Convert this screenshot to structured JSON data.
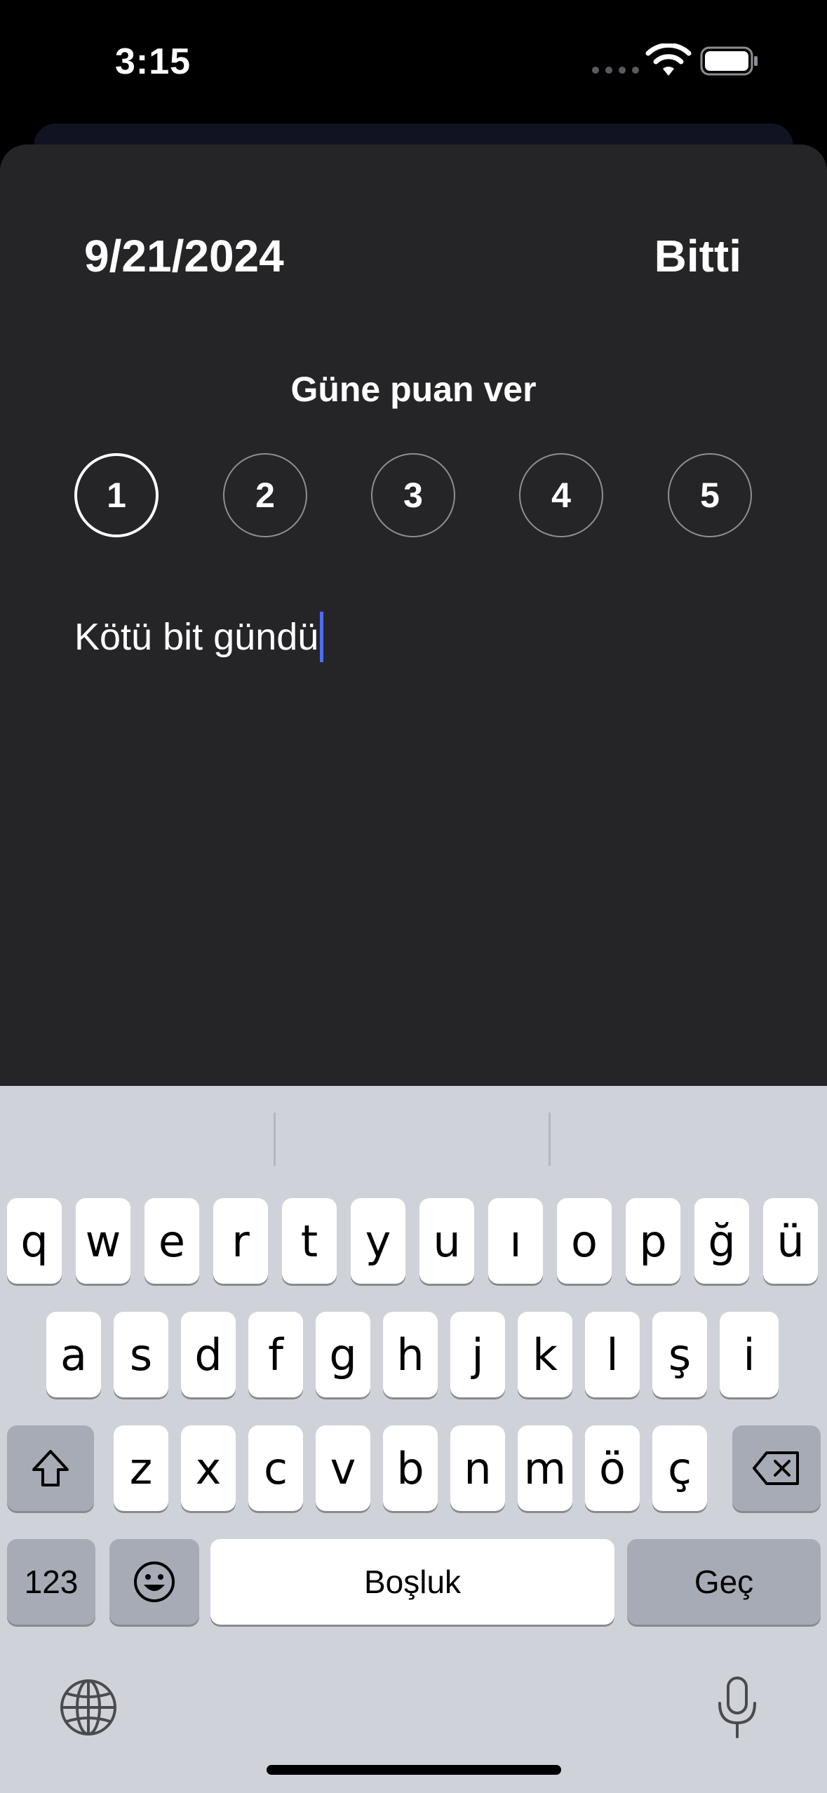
{
  "status_bar": {
    "time": "3:15"
  },
  "header": {
    "date": "9/21/2024",
    "done_label": "Bitti"
  },
  "rating": {
    "label": "Güne puan ver",
    "options": [
      "1",
      "2",
      "3",
      "4",
      "5"
    ],
    "selected": "1"
  },
  "note": {
    "value": "Kötü bit gündü"
  },
  "keyboard": {
    "row1": [
      "q",
      "w",
      "e",
      "r",
      "t",
      "y",
      "u",
      "ı",
      "o",
      "p",
      "ğ",
      "ü"
    ],
    "row2": [
      "a",
      "s",
      "d",
      "f",
      "g",
      "h",
      "j",
      "k",
      "l",
      "ş",
      "i"
    ],
    "row3": [
      "z",
      "x",
      "c",
      "v",
      "b",
      "n",
      "m",
      "ö",
      "ç"
    ],
    "numbers_label": "123",
    "space_label": "Boşluk",
    "return_label": "Geç",
    "icons": [
      "shift-icon",
      "backspace-icon",
      "emoji-icon",
      "globe-icon",
      "microphone-icon"
    ]
  },
  "colors": {
    "sheet": "#252528",
    "keyboard": "#cfd2d9",
    "caret": "#4b6ef5"
  }
}
